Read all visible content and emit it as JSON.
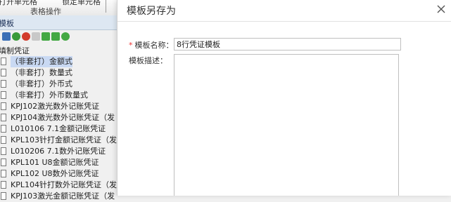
{
  "toolbar": {
    "btn_left": "打开单元格",
    "btn_right": "锁定单元格",
    "group_label": "表格操作"
  },
  "panel": {
    "title": "模板"
  },
  "icons": [
    "template-icon",
    "add-icon",
    "delete-icon",
    "cut-icon",
    "move-left-icon",
    "move-right-icon",
    "refresh-icon"
  ],
  "tree": {
    "root_label": "填制凭证",
    "items": [
      {
        "label": "（非套打）金额式",
        "selected": true
      },
      {
        "label": "（非套打）数量式",
        "selected": false
      },
      {
        "label": "（非套打）外币式",
        "selected": false
      },
      {
        "label": "（非套打）外币数量式",
        "selected": false
      },
      {
        "label": "KPJ102激光数外记账凭证",
        "selected": false
      },
      {
        "label": "KPJ104激光数外记账凭证（发",
        "selected": false
      },
      {
        "label": "L010106 7.1金额记账凭证",
        "selected": false
      },
      {
        "label": "KPL103针打金额记账凭证（发",
        "selected": false
      },
      {
        "label": "L010206 7.1数外记账凭证",
        "selected": false
      },
      {
        "label": "KPL101 U8金额记账凭证",
        "selected": false
      },
      {
        "label": "KPL102 U8数外记账凭证",
        "selected": false
      },
      {
        "label": "KPL104针打数外记账凭证（发",
        "selected": false
      },
      {
        "label": "KPJ103激光金额记账凭证（发",
        "selected": false
      }
    ]
  },
  "dialog": {
    "title": "模板另存为",
    "name_label": "模板名称：",
    "name_value": "8行凭证模板",
    "desc_label": "模板描述：",
    "desc_value": ""
  },
  "colors": {
    "required_star": "#e33333",
    "selected_row": "#c9d9f3",
    "panel_header": "#dde7f2"
  }
}
